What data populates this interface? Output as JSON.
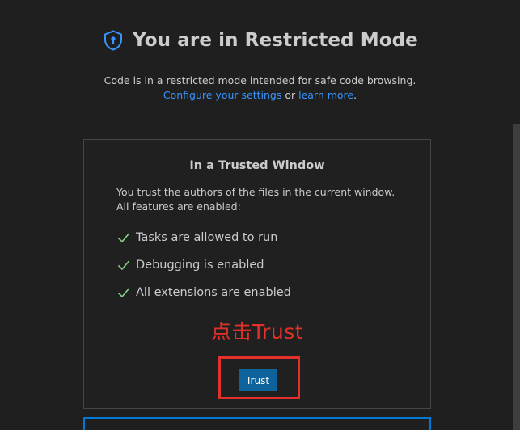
{
  "header": {
    "title": "You are in Restricted Mode",
    "icon": "shield-lock-icon",
    "icon_color": "#3794ff"
  },
  "description": {
    "line1": "Code is in a restricted mode intended for safe code browsing.",
    "configure_link": "Configure your settings",
    "connector": " or ",
    "learn_link": "learn more",
    "end": "."
  },
  "trusted_card": {
    "title": "In a Trusted Window",
    "description": "You trust the authors of the files in the current window. All features are enabled:",
    "features": [
      {
        "label": "Tasks are allowed to run",
        "icon": "check-icon"
      },
      {
        "label": "Debugging is enabled",
        "icon": "check-icon"
      },
      {
        "label": "All extensions are enabled",
        "icon": "check-icon"
      }
    ],
    "annotation": "点击Trust",
    "button_label": "Trust"
  },
  "colors": {
    "background": "#1f1f1f",
    "text": "#cccccc",
    "link": "#3794ff",
    "check": "#89d185",
    "button": "#0e639c",
    "annotation_red": "#e3302a",
    "focus_border": "#0078d4"
  }
}
